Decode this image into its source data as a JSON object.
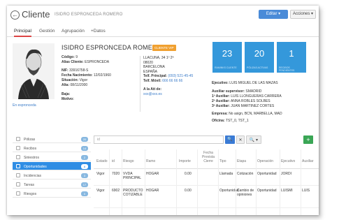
{
  "header": {
    "title": "Cliente",
    "subtitle": "ISIDRO ESPRONCEDA ROMERO",
    "edit_label": "Editar ▾",
    "actions_label": "Acciones ▾"
  },
  "tabs": [
    {
      "label": "Principal"
    },
    {
      "label": "Gestión"
    },
    {
      "label": "Agrupación"
    },
    {
      "label": "+Datos"
    }
  ],
  "profile": {
    "name": "ISIDRO ESPRONCEDA ROMERO",
    "badge": "CLIENTE VIP",
    "link": "En espronceda",
    "codigo_label": "Código:",
    "codigo": "9",
    "alias_label": "Alias Cliente:",
    "alias": "ESPRONCEDA",
    "nif_label": "NIF:",
    "nif": "33916758-S",
    "nacimiento_label": "Fecha Nacimiento:",
    "nacimiento": "12/02/1960",
    "situacion_label": "Situación:",
    "situacion": "Vigor",
    "alta_label": "Alta:",
    "alta": "08/11/2000",
    "baja_label": "Baja:",
    "motivo_label": "Motivo:"
  },
  "address": {
    "street": "LLACUNA, 34 1º 2ª",
    "zip": "08020",
    "city": "BARCELONA",
    "country": "ESPAÑA",
    "tel_label": "Telf. Principal:",
    "tel": "(093) 521-45-45",
    "mov_label": "Telf. Móvil:",
    "mov": "666 66 66 66",
    "att_label": "A la Att de:",
    "email": "xxx@xxx.es"
  },
  "stats": [
    {
      "value": "23",
      "caption": "RAMINKS CLIENTE"
    },
    {
      "value": "20",
      "caption": "PÓLIZAS ACTIVAS"
    },
    {
      "value": "1",
      "caption": "RECIBOS PENDIENTES"
    }
  ],
  "staff": {
    "ejecutivo_label": "Ejecutivo:",
    "ejecutivo": "LUIS MIGUEL DE LAS MAZAS",
    "supervisor_label": "Auxiliar supervisor:",
    "supervisor": "SMADRID",
    "aux1_label": "1º Auxiliar:",
    "aux1": "LUIS LLONGUERAS CARRERA",
    "aux2_label": "2º Auxiliar:",
    "aux2": "ANNA ROBLES SOLBES",
    "aux3_label": "3º Auxiliar:",
    "aux3": "JUAN MARTINEZ CORTES",
    "empresa_label": "Empresa:",
    "empresa": "No asign, BCN, MARBELLA, MAD",
    "oficina_label": "Oficina:",
    "oficina": "TST_0, TST_1"
  },
  "sidebar": [
    {
      "label": "Pólizas",
      "count": "20",
      "icon": "policy-icon"
    },
    {
      "label": "Recibos",
      "count": "14",
      "icon": "receipt-icon"
    },
    {
      "label": "Siniestros",
      "count": "2",
      "icon": "claim-icon"
    },
    {
      "label": "Oportunidades",
      "count": "8",
      "icon": "opportunity-icon"
    },
    {
      "label": "Incidencias",
      "count": "3",
      "icon": "incident-icon"
    },
    {
      "label": "Tareas",
      "count": "17",
      "icon": "task-icon"
    },
    {
      "label": "Riesgos",
      "count": "0",
      "icon": "risk-icon"
    }
  ],
  "search": {
    "placeholder": "id",
    "search_btn": "🔍",
    "clear_btn": "✕",
    "zoom_btn": "🔍 ▾",
    "add_btn": "+"
  },
  "table": {
    "columns": [
      "Estado",
      "id",
      "Riesgo",
      "Ramo",
      "Importe",
      "Fecha Prevista Cierre",
      "Tipo",
      "Etapa",
      "Operación",
      "Ejecutivo",
      "Auxiliar"
    ],
    "rows": [
      [
        "Vigor",
        "7020",
        "VVDA PRINCIPAL",
        "HOGAR",
        "0.00",
        "",
        "Llamada",
        "Cotización",
        "Oportunidad",
        "JORDI",
        ""
      ],
      [
        "Vigor",
        "6902",
        "PRODUCTO COTIZABLE",
        "HOGAR",
        "0.00",
        "",
        "Oportunidad",
        "Cambio de opiniones",
        "Oportunidad",
        "LUISMI",
        "LUIS"
      ]
    ]
  }
}
